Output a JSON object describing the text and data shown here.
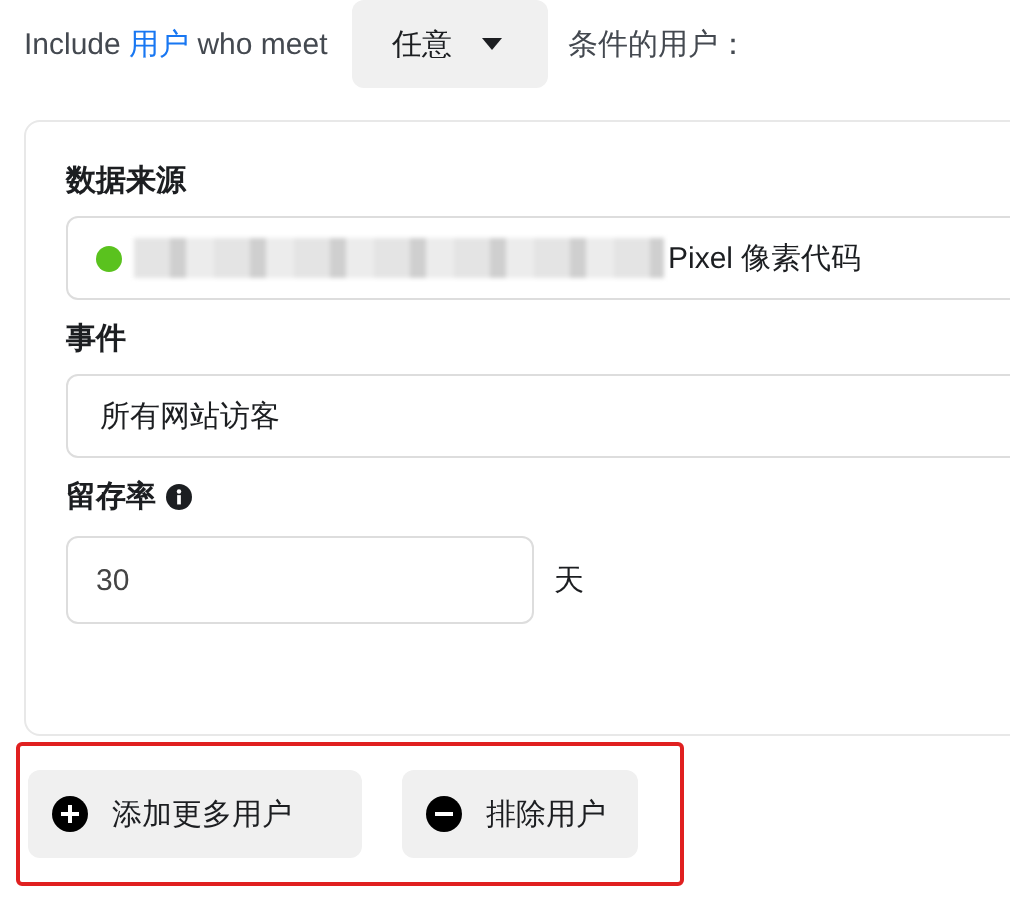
{
  "header": {
    "prefix": "Include",
    "link": "用户",
    "middle": "who meet",
    "dropdown": {
      "label": "任意"
    },
    "suffix": "条件的用户："
  },
  "data_source": {
    "label": "数据来源",
    "connected": true,
    "value": "Pixel 像素代码"
  },
  "event": {
    "label": "事件",
    "value": "所有网站访客"
  },
  "retention": {
    "label": "留存率",
    "value": "30",
    "unit": "天"
  },
  "actions": {
    "highlighted": true,
    "buttons": [
      {
        "label": "添加更多用户",
        "kind": "add"
      },
      {
        "label": "排除用户",
        "kind": "exclude"
      }
    ]
  }
}
